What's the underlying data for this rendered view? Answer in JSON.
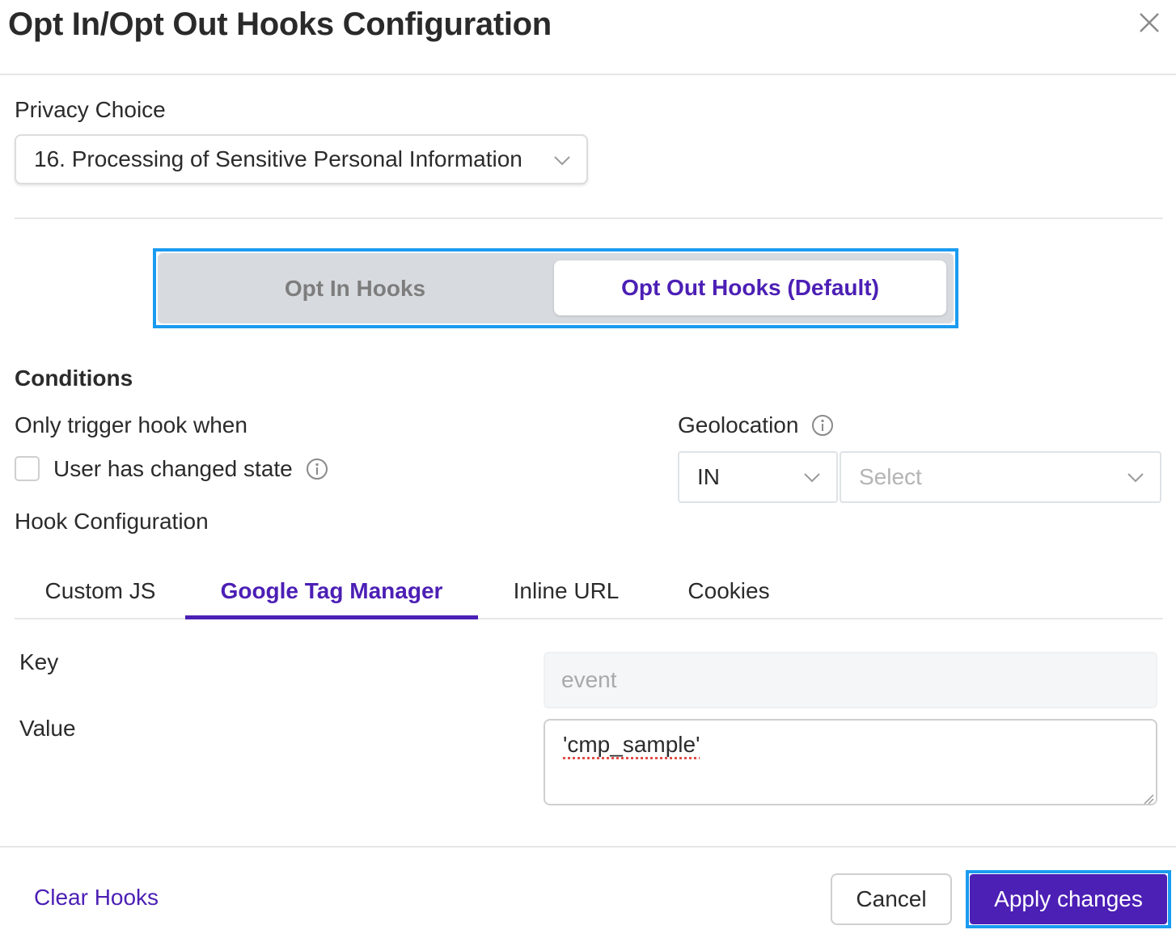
{
  "dialog": {
    "title": "Opt In/Opt Out Hooks Configuration",
    "close_icon": "close-icon"
  },
  "privacy_choice": {
    "label": "Privacy Choice",
    "selected": "16. Processing of Sensitive Personal Information"
  },
  "hook_type": {
    "options": [
      "Opt In Hooks",
      "Opt Out Hooks (Default)"
    ],
    "selected": "Opt Out Hooks (Default)"
  },
  "conditions": {
    "heading": "Conditions",
    "trigger_label": "Only trigger hook when",
    "user_changed_state": {
      "label": "User has changed state",
      "checked": false
    },
    "geolocation": {
      "label": "Geolocation",
      "operator": "IN",
      "value_placeholder": "Select"
    }
  },
  "hook_configuration": {
    "label": "Hook Configuration",
    "tabs": [
      "Custom JS",
      "Google Tag Manager",
      "Inline URL",
      "Cookies"
    ],
    "active_tab": "Google Tag Manager",
    "key_label": "Key",
    "key_value": "event",
    "value_label": "Value",
    "value_value": "'cmp_sample'"
  },
  "footer": {
    "clear_label": "Clear Hooks",
    "cancel_label": "Cancel",
    "apply_label": "Apply changes"
  },
  "colors": {
    "accent": "#4c1fb5",
    "focus_outline": "#1a9bf0",
    "segment_track": "#d7dbdf"
  }
}
